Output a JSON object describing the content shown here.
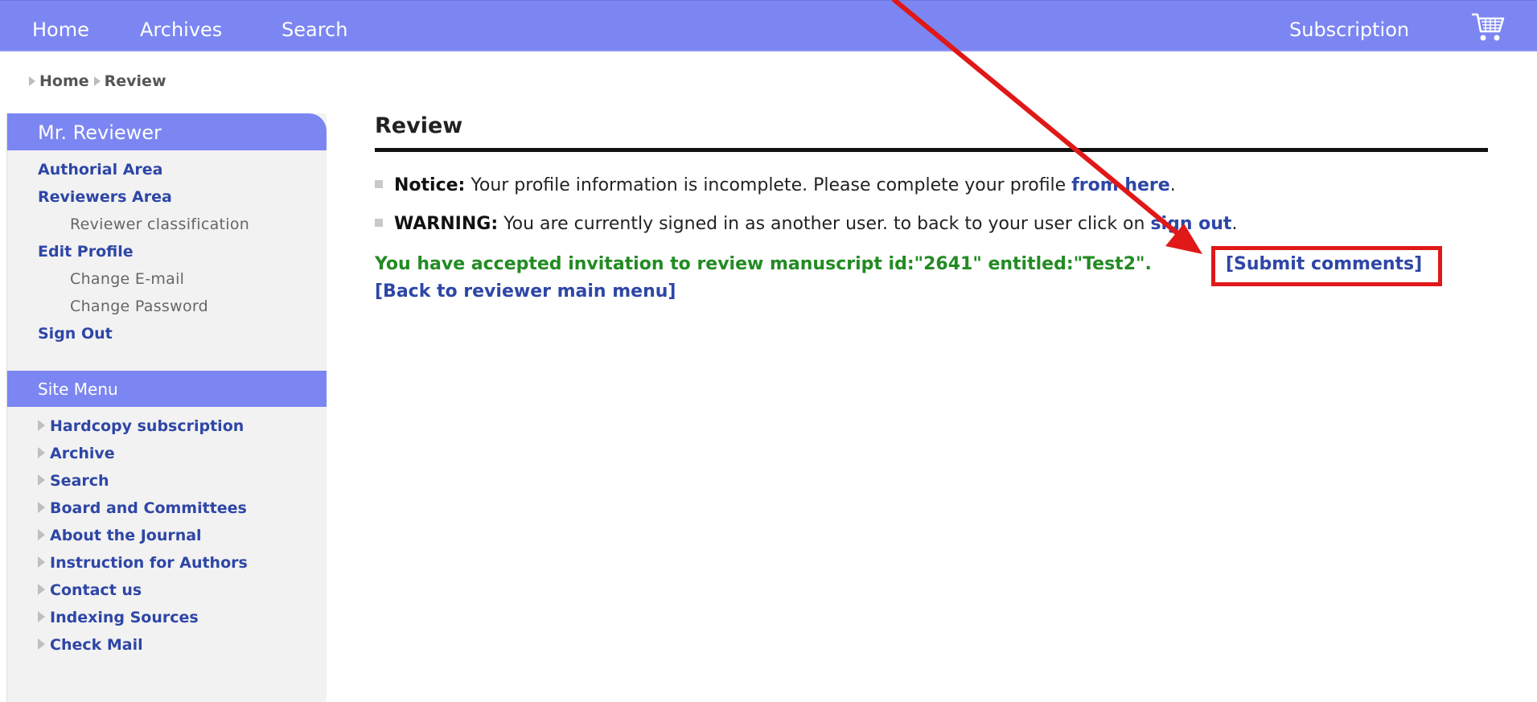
{
  "topnav": {
    "home": "Home",
    "archives": "Archives",
    "search": "Search",
    "subscription": "Subscription",
    "cart_icon": "shopping-cart-icon"
  },
  "breadcrumb": {
    "items": [
      "Home",
      "Review"
    ]
  },
  "sidebar": {
    "user_title": "Mr. Reviewer",
    "user_menu": [
      {
        "label": "Authorial Area"
      },
      {
        "label": "Reviewers Area"
      },
      {
        "label": "Reviewer classification"
      },
      {
        "label": "Edit Profile"
      },
      {
        "label": "Change E-mail"
      },
      {
        "label": "Change Password"
      },
      {
        "label": "Sign Out"
      }
    ],
    "site_menu_title": "Site Menu",
    "site_menu": [
      {
        "label": "Hardcopy subscription"
      },
      {
        "label": "Archive"
      },
      {
        "label": "Search"
      },
      {
        "label": "Board and Committees"
      },
      {
        "label": "About the Journal"
      },
      {
        "label": "Instruction for Authors"
      },
      {
        "label": "Contact us"
      },
      {
        "label": "Indexing Sources"
      },
      {
        "label": "Check Mail"
      }
    ]
  },
  "main": {
    "title": "Review",
    "notice": {
      "label": "Notice:",
      "text": " Your profile information is incomplete. Please complete your profile ",
      "link": "from here",
      "end": "."
    },
    "warning": {
      "label": "WARNING:",
      "text": " You are currently signed in as another user. to back to your user click on ",
      "link": "sign out",
      "end": "."
    },
    "accepted_text": "You have accepted invitation to review manuscript id:\"2641\" entitled:\"Test2\".",
    "submit_comments": "[Submit comments]",
    "back_to_menu": "[Back to reviewer main menu]"
  },
  "annotation": {
    "color": "#e01818"
  },
  "colors": {
    "nav_bg": "#7b86f2",
    "link": "#2e46a6",
    "success": "#228b22"
  }
}
